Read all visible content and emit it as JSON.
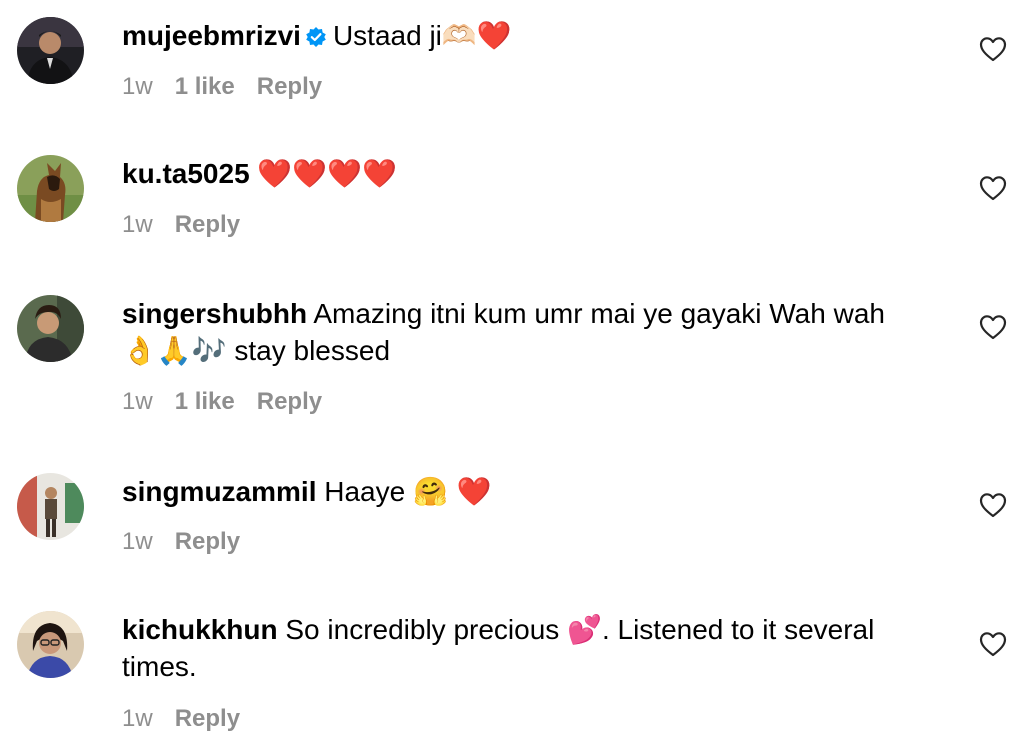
{
  "comments": [
    {
      "username": "mujeebmrizvi",
      "verified": true,
      "text": "Ustaad ji",
      "emoji": "🫶🏻❤️",
      "time": "1w",
      "likes": "1 like",
      "reply": "Reply",
      "avatar": "avatar-man-dark-suit"
    },
    {
      "username": "ku.ta5025",
      "text": "",
      "emoji": "❤️❤️❤️❤️",
      "time": "1w",
      "reply": "Reply",
      "avatar": "avatar-dog"
    },
    {
      "username": "singershubhh",
      "text": "Amazing itni kum umr mai ye gayaki Wah wah",
      "line2_emoji": "👌🙏🎶",
      "line2_text": " stay blessed",
      "time": "1w",
      "likes": "1 like",
      "reply": "Reply",
      "avatar": "avatar-man-curly-hair"
    },
    {
      "username": "singmuzammil",
      "text": "Haaye",
      "emoji": "🤗 ❤️",
      "time": "1w",
      "reply": "Reply",
      "avatar": "avatar-man-standing"
    },
    {
      "username": "kichukkhun",
      "text": "So incredibly precious",
      "emoji": "💕",
      "text_after": ". Listened to it several times.",
      "time": "1w",
      "reply": "Reply",
      "avatar": "avatar-woman-glasses"
    }
  ],
  "colors": {
    "meta_gray": "#8e8e8e",
    "verified_blue": "#0095f6",
    "heart_stroke": "#262626"
  },
  "icons": {
    "like": "heart-outline-icon",
    "verified": "verified-badge-icon"
  }
}
